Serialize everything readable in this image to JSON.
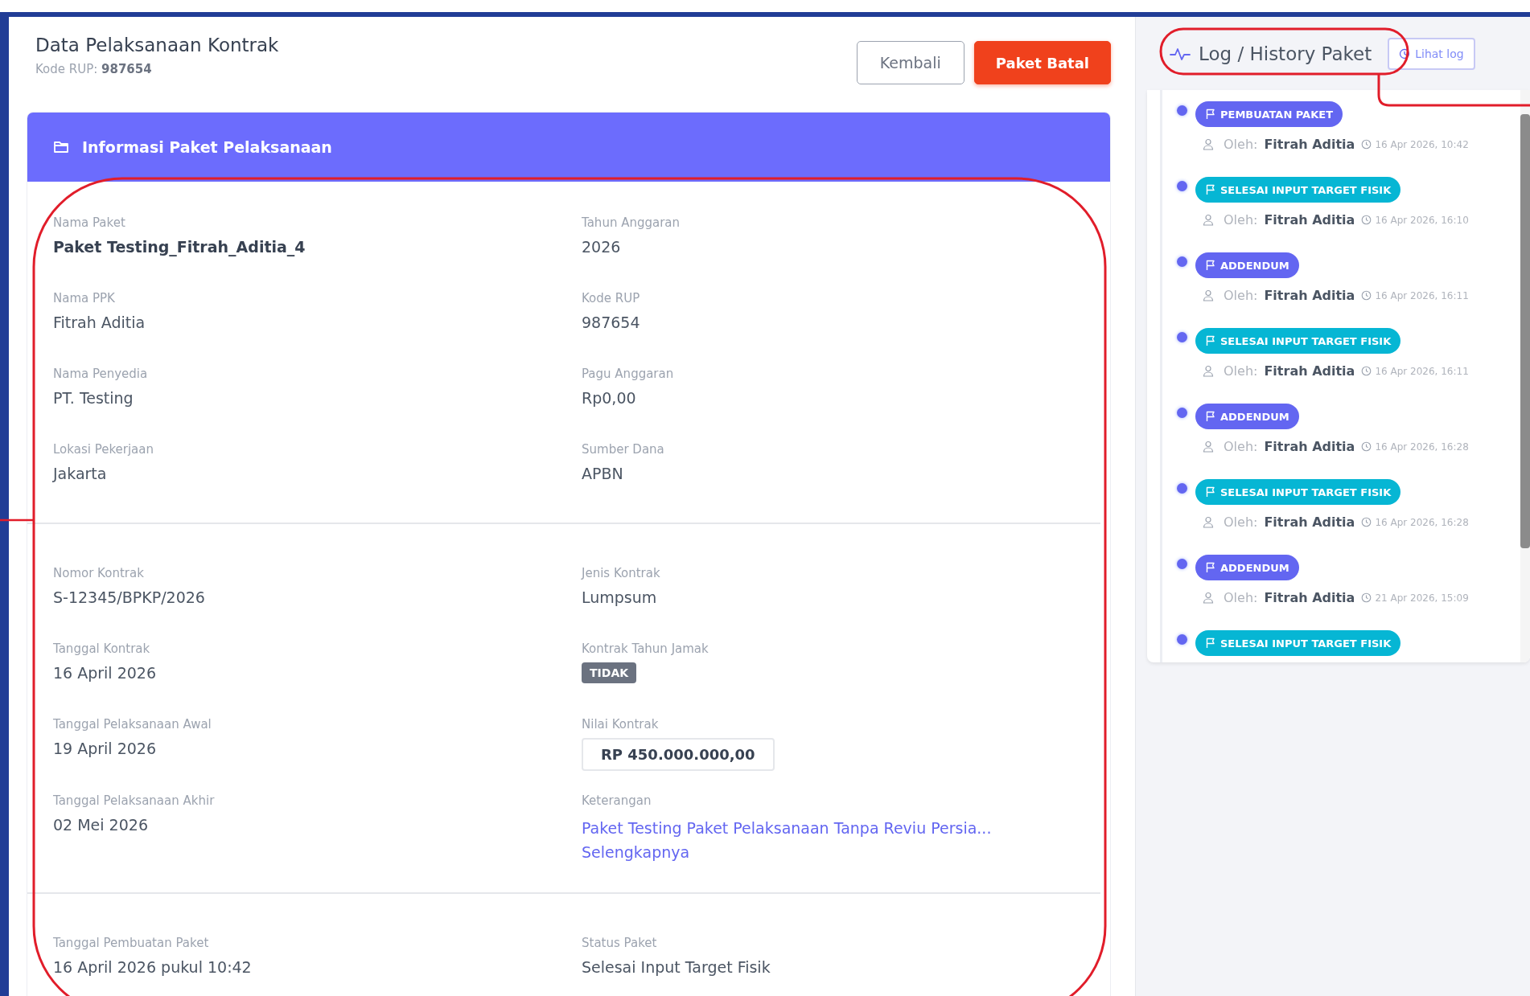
{
  "header": {
    "title": "Data Pelaksanaan Kontrak",
    "subtitle_label": "Kode RUP:",
    "subtitle_value": "987654"
  },
  "buttons": [
    {
      "label": "Kembali",
      "kind": "outline"
    },
    {
      "label": "Paket Batal",
      "kind": "danger"
    }
  ],
  "info_card": {
    "title": "Informasi Paket Pelaksanaan",
    "sections": [
      {
        "fields": [
          {
            "label": "Nama Paket",
            "value": "Paket Testing_Fitrah_Aditia_4",
            "kind": "strong"
          },
          {
            "label": "Tahun Anggaran",
            "value": "2026",
            "kind": "text"
          },
          {
            "label": "Nama PPK",
            "value": "Fitrah Aditia",
            "kind": "text"
          },
          {
            "label": "Kode RUP",
            "value": "987654",
            "kind": "text"
          },
          {
            "label": "Nama Penyedia",
            "value": "PT. Testing",
            "kind": "text"
          },
          {
            "label": "Pagu Anggaran",
            "value": "Rp0,00",
            "kind": "text"
          },
          {
            "label": "Lokasi Pekerjaan",
            "value": "Jakarta",
            "kind": "text"
          },
          {
            "label": "Sumber Dana",
            "value": "APBN",
            "kind": "text"
          }
        ]
      },
      {
        "fields": [
          {
            "label": "Nomor Kontrak",
            "value": "S-12345/BPKP/2026",
            "kind": "text"
          },
          {
            "label": "Jenis Kontrak",
            "value": "Lumpsum",
            "kind": "text"
          },
          {
            "label": "Tanggal Kontrak",
            "value": "16 April 2026",
            "kind": "text"
          },
          {
            "label": "Kontrak Tahun Jamak",
            "value": "TIDAK",
            "kind": "badge"
          },
          {
            "label": "Tanggal Pelaksanaan Awal",
            "value": "19 April 2026",
            "kind": "text"
          },
          {
            "label": "Nilai Kontrak",
            "value": "RP 450.000.000,00",
            "kind": "boxed"
          },
          {
            "label": "Tanggal Pelaksanaan Akhir",
            "value": "02 Mei 2026",
            "kind": "text"
          },
          {
            "label": "Keterangan",
            "value": "Paket Testing Paket Pelaksanaan Tanpa Reviu Persia...",
            "more": "Selengkapnya",
            "kind": "link"
          }
        ]
      },
      {
        "fields": [
          {
            "label": "Tanggal Pembuatan Paket",
            "value": "16 April 2026 pukul 10:42",
            "kind": "text"
          },
          {
            "label": "Status Paket",
            "value": "Selesai Input Target Fisik",
            "kind": "text"
          }
        ]
      }
    ]
  },
  "log": {
    "title": "Log / History Paket",
    "button": "Lihat log",
    "entries": [
      {
        "label": "PEMBUATAN PAKET",
        "color": "#6366f1",
        "prefix": "Oleh:",
        "author": "Fitrah Aditia",
        "time": "16 Apr 2026, 10:42"
      },
      {
        "label": "SELESAI INPUT TARGET FISIK",
        "color": "#06b6d4",
        "prefix": "Oleh:",
        "author": "Fitrah Aditia",
        "time": "16 Apr 2026, 16:10"
      },
      {
        "label": "ADDENDUM",
        "color": "#6366f1",
        "prefix": "Oleh:",
        "author": "Fitrah Aditia",
        "time": "16 Apr 2026, 16:11"
      },
      {
        "label": "SELESAI INPUT TARGET FISIK",
        "color": "#06b6d4",
        "prefix": "Oleh:",
        "author": "Fitrah Aditia",
        "time": "16 Apr 2026, 16:11"
      },
      {
        "label": "ADDENDUM",
        "color": "#6366f1",
        "prefix": "Oleh:",
        "author": "Fitrah Aditia",
        "time": "16 Apr 2026, 16:28"
      },
      {
        "label": "SELESAI INPUT TARGET FISIK",
        "color": "#06b6d4",
        "prefix": "Oleh:",
        "author": "Fitrah Aditia",
        "time": "16 Apr 2026, 16:28"
      },
      {
        "label": "ADDENDUM",
        "color": "#6366f1",
        "prefix": "Oleh:",
        "author": "Fitrah Aditia",
        "time": "21 Apr 2026, 15:09"
      },
      {
        "label": "SELESAI INPUT TARGET FISIK",
        "color": "#06b6d4"
      }
    ]
  }
}
